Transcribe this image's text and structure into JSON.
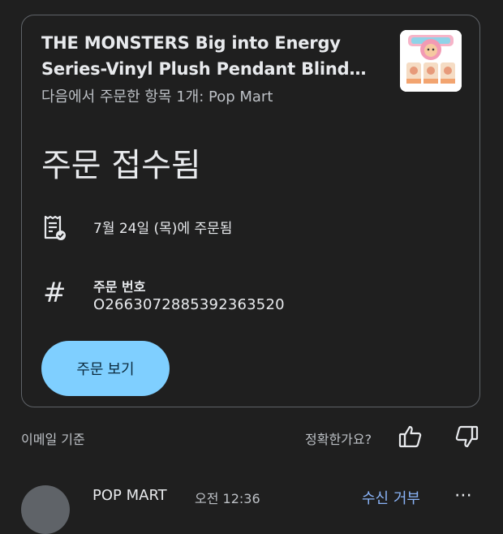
{
  "order_card": {
    "title_line1": "THE MONSTERS Big into Energy",
    "title_line2": "Series-Vinyl Plush Pendant Blind…",
    "subtitle": "다음에서 주문한 항목 1개: Pop Mart",
    "status": "주문 접수됨",
    "date_text": "7월 24일 (목)에 주문됨",
    "order_number_label": "주문 번호",
    "order_number": "O2663072885392363520",
    "view_button_label": "주문 보기",
    "icons": [
      "receipt-icon",
      "hash-icon"
    ],
    "accent_color": "#7fcfff"
  },
  "footer": {
    "source_text": "이메일 기준",
    "accuracy_question": "정확한가요?",
    "icons": [
      "thumbs-up-icon",
      "thumbs-down-icon"
    ]
  },
  "message_header": {
    "sender": "POP MART",
    "time": "오전 12:36",
    "unsubscribe_label": "수신 거부",
    "more_label": "⋯"
  }
}
